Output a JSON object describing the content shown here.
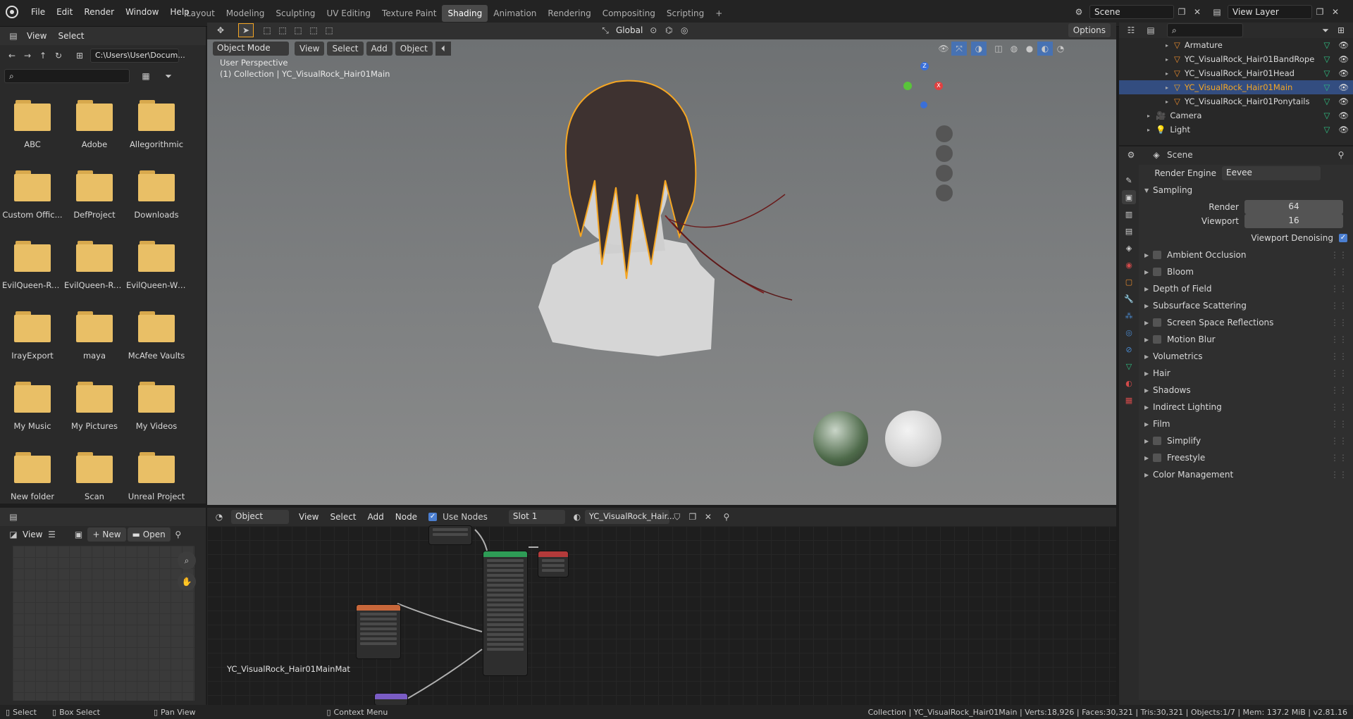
{
  "menu": {
    "file": "File",
    "edit": "Edit",
    "render": "Render",
    "window": "Window",
    "help": "Help"
  },
  "workspaces": [
    "Layout",
    "Modeling",
    "Sculpting",
    "UV Editing",
    "Texture Paint",
    "Shading",
    "Animation",
    "Rendering",
    "Compositing",
    "Scripting"
  ],
  "active_workspace": "Shading",
  "scene": {
    "name": "Scene",
    "view_layer": "View Layer"
  },
  "file_browser": {
    "view": "View",
    "select": "Select",
    "path": "C:\\Users\\User\\Docum...",
    "folders": [
      "ABC",
      "Adobe",
      "Allegorithmic",
      "Custom Offic...",
      "DefProject",
      "Downloads",
      "EvilQueen-Re...",
      "EvilQueen-Re...",
      "EvilQueen-Wi...",
      "IrayExport",
      "maya",
      "McAfee Vaults",
      "My Music",
      "My Pictures",
      "My Videos",
      "New folder",
      "Scan",
      "Unreal Project"
    ]
  },
  "image_editor": {
    "view": "View",
    "new": "New",
    "open": "Open"
  },
  "viewport": {
    "mode": "Object Mode",
    "view": "View",
    "select": "Select",
    "add": "Add",
    "object": "Object",
    "transform": "Global",
    "options": "Options",
    "perspective": "User Perspective",
    "collection": "(1) Collection | YC_VisualRock_Hair01Main"
  },
  "node_editor": {
    "type": "Object",
    "view": "View",
    "select": "Select",
    "add": "Add",
    "node": "Node",
    "use_nodes": "Use Nodes",
    "slot": "Slot 1",
    "material": "YC_VisualRock_Hair...",
    "material_label": "YC_VisualRock_Hair01MainMat"
  },
  "outliner": {
    "items": [
      {
        "name": "Armature",
        "selected": false,
        "icon_color": "#2fbf83"
      },
      {
        "name": "YC_VisualRock_Hair01BandRope",
        "selected": false,
        "icon_color": "#2fbf83"
      },
      {
        "name": "YC_VisualRock_Hair01Head",
        "selected": false,
        "icon_color": "#2fbf83"
      },
      {
        "name": "YC_VisualRock_Hair01Main",
        "selected": true,
        "icon_color": "#2fbf83"
      },
      {
        "name": "YC_VisualRock_Hair01Ponytails",
        "selected": false,
        "icon_color": "#2fbf83"
      },
      {
        "name": "Camera",
        "selected": false,
        "icon_color": "#2fbf83"
      },
      {
        "name": "Light",
        "selected": false,
        "icon_color": "#2fbf83"
      }
    ]
  },
  "properties": {
    "scene": "Scene",
    "render_engine_label": "Render Engine",
    "render_engine": "Eevee",
    "sampling": "Sampling",
    "render_label": "Render",
    "render_value": "64",
    "viewport_label": "Viewport",
    "viewport_value": "16",
    "denoise": "Viewport Denoising",
    "panels": [
      {
        "label": "Ambient Occlusion",
        "checkbox": true
      },
      {
        "label": "Bloom",
        "checkbox": true
      },
      {
        "label": "Depth of Field",
        "checkbox": false
      },
      {
        "label": "Subsurface Scattering",
        "checkbox": false
      },
      {
        "label": "Screen Space Reflections",
        "checkbox": true
      },
      {
        "label": "Motion Blur",
        "checkbox": true
      },
      {
        "label": "Volumetrics",
        "checkbox": false
      },
      {
        "label": "Hair",
        "checkbox": false
      },
      {
        "label": "Shadows",
        "checkbox": false
      },
      {
        "label": "Indirect Lighting",
        "checkbox": false
      },
      {
        "label": "Film",
        "checkbox": false
      },
      {
        "label": "Simplify",
        "checkbox": true
      },
      {
        "label": "Freestyle",
        "checkbox": true
      },
      {
        "label": "Color Management",
        "checkbox": false
      }
    ]
  },
  "statusbar": {
    "select": "Select",
    "box_select": "Box Select",
    "pan_view": "Pan View",
    "context_menu": "Context Menu",
    "info": "Collection | YC_VisualRock_Hair01Main | Verts:18,926 | Faces:30,321 | Tris:30,321 | Objects:1/7 | Mem: 137.2 MiB | v2.81.16"
  },
  "colors": {
    "accent": "#4772b3",
    "selected_row": "#334d80",
    "selection_outline": "#f5a623"
  }
}
